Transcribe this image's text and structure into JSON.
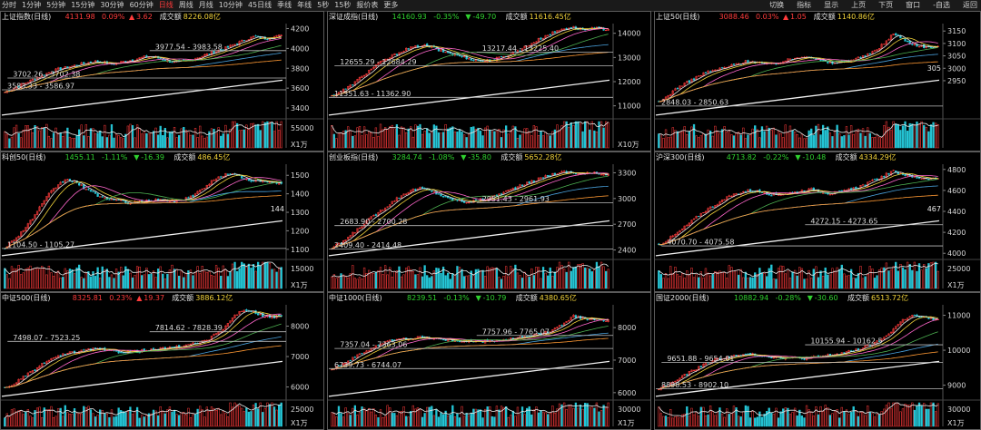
{
  "toolbar": {
    "periods": [
      "分时",
      "1分钟",
      "5分钟",
      "15分钟",
      "30分钟",
      "60分钟",
      "日线",
      "周线",
      "月线",
      "10分钟",
      "45日线",
      "季线",
      "年线",
      "5秒",
      "15秒",
      "报价表",
      "更多"
    ],
    "active_period": "日线",
    "actions": [
      "切换",
      "指标",
      "显示",
      "上页",
      "下页",
      "窗口",
      "-自选",
      "返回"
    ]
  },
  "colors": {
    "up": "#ff3b3b",
    "down": "#2fd22f",
    "white": "#e8e8e8",
    "yellow": "#f2d33a",
    "ma_green": "#4caf50",
    "ma_blue": "#4aa3df",
    "ma_pink": "#ff66cc",
    "ma_orange": "#ff9933",
    "grid": "#3a3a3a",
    "border": "#5a5a5a"
  },
  "panels": [
    {
      "name": "上证指数(日线)",
      "price": "4131.98",
      "pct": "0.09%",
      "chg_sign": "▲",
      "chg": "3.62",
      "vol_label": "成交额",
      "vol": "8226.08亿",
      "dir": "up",
      "y_ticks": [
        "4200",
        "4000",
        "3800",
        "3600",
        "3400"
      ],
      "vol_tick": "55000",
      "vol_unit": "X1万",
      "levels": [
        "3977.54 - 3983.58",
        "3702.26 - 3702.38",
        "3583.33 - 3586.97"
      ],
      "side_label": "",
      "chart_data": {
        "type": "candlestick",
        "ylim": [
          3300,
          4250
        ],
        "close_path": [
          3560,
          3600,
          3640,
          3680,
          3720,
          3760,
          3790,
          3810,
          3830,
          3850,
          3870,
          3860,
          3840,
          3860,
          3880,
          3900,
          3920,
          3910,
          3880,
          3860,
          3870,
          3890,
          3920,
          3950,
          3980,
          4010,
          4050,
          4090,
          4120,
          4100,
          4110,
          4131.98
        ]
      }
    },
    {
      "name": "深证成指(日线)",
      "price": "14160.93",
      "pct": "-0.35%",
      "chg_sign": "▼",
      "chg": "-49.70",
      "vol_label": "成交额",
      "vol": "11616.45亿",
      "dir": "down",
      "y_ticks": [
        "14000",
        "13000",
        "12000",
        "11000"
      ],
      "vol_tick": "",
      "vol_unit": "X10万",
      "levels": [
        "13217.44 - 13225.40",
        "12655.29 - 12684.29",
        "11351.63 - 11362.90"
      ],
      "side_label": "",
      "chart_data": {
        "type": "candlestick",
        "ylim": [
          10500,
          14400
        ],
        "close_path": [
          11400,
          11600,
          11800,
          12100,
          12400,
          12700,
          12900,
          13100,
          13300,
          13400,
          13500,
          13450,
          13300,
          13200,
          13100,
          13000,
          12900,
          12850,
          12900,
          13000,
          13150,
          13300,
          13500,
          13700,
          13900,
          14050,
          14200,
          14250,
          14150,
          14180,
          14200,
          14160.93
        ]
      }
    },
    {
      "name": "上证50(日线)",
      "price": "3088.46",
      "pct": "0.03%",
      "chg_sign": "▲",
      "chg": "1.05",
      "vol_label": "成交额",
      "vol": "1140.86亿",
      "dir": "up",
      "y_ticks": [
        "3150",
        "3100",
        "3050",
        "3000",
        "2950"
      ],
      "vol_tick": "",
      "vol_unit": "",
      "levels": [
        "2848.03 - 2850.63"
      ],
      "side_label": "305",
      "chart_data": {
        "type": "candlestick",
        "ylim": [
          2800,
          3180
        ],
        "close_path": [
          2860,
          2890,
          2920,
          2940,
          2960,
          2980,
          2990,
          3000,
          3010,
          3020,
          3030,
          3025,
          3015,
          3020,
          3030,
          3040,
          3050,
          3045,
          3030,
          3020,
          3025,
          3030,
          3040,
          3050,
          3070,
          3100,
          3140,
          3120,
          3100,
          3090,
          3085,
          3088.46
        ]
      }
    },
    {
      "name": "科创50(日线)",
      "price": "1455.11",
      "pct": "-1.11%",
      "chg_sign": "▼",
      "chg": "-16.39",
      "vol_label": "成交额",
      "vol": "486.45亿",
      "dir": "down",
      "y_ticks": [
        "1500",
        "1400",
        "1300",
        "1200",
        "1100"
      ],
      "vol_tick": "15000",
      "vol_unit": "X1万",
      "levels": [
        "1104.50 - 1105.27"
      ],
      "side_label": "144",
      "chart_data": {
        "type": "candlestick",
        "ylim": [
          1050,
          1560
        ],
        "close_path": [
          1110,
          1150,
          1200,
          1260,
          1330,
          1400,
          1450,
          1480,
          1460,
          1430,
          1400,
          1380,
          1370,
          1360,
          1350,
          1355,
          1360,
          1370,
          1365,
          1360,
          1370,
          1390,
          1420,
          1460,
          1490,
          1510,
          1500,
          1480,
          1470,
          1465,
          1460,
          1455.11
        ]
      }
    },
    {
      "name": "创业板指(日线)",
      "price": "3284.74",
      "pct": "-1.08%",
      "chg_sign": "▼",
      "chg": "-35.80",
      "vol_label": "成交额",
      "vol": "5652.28亿",
      "dir": "down",
      "y_ticks": [
        "3300",
        "3000",
        "2700",
        "2400"
      ],
      "vol_tick": "",
      "vol_unit": "",
      "levels": [
        "2951.43 - 2961.93",
        "2683.90 - 2700.28",
        "2409.40 - 2414.48"
      ],
      "side_label": "",
      "chart_data": {
        "type": "candlestick",
        "ylim": [
          2300,
          3400
        ],
        "close_path": [
          2420,
          2480,
          2560,
          2650,
          2740,
          2820,
          2900,
          2980,
          3050,
          3100,
          3120,
          3090,
          3050,
          3000,
          2980,
          2960,
          2970,
          2990,
          3020,
          3060,
          3100,
          3140,
          3180,
          3220,
          3260,
          3290,
          3310,
          3300,
          3290,
          3295,
          3290,
          3284.74
        ]
      }
    },
    {
      "name": "沪深300(日线)",
      "price": "4713.82",
      "pct": "-0.22%",
      "chg_sign": "▼",
      "chg": "-10.48",
      "vol_label": "成交额",
      "vol": "4334.29亿",
      "dir": "down",
      "y_ticks": [
        "4800",
        "4600",
        "4400",
        "4200",
        "4000"
      ],
      "vol_tick": "25000",
      "vol_unit": "X1万",
      "levels": [
        "4272.15 - 4273.65",
        "4070.70 - 4075.58"
      ],
      "side_label": "467",
      "chart_data": {
        "type": "candlestick",
        "ylim": [
          3950,
          4850
        ],
        "close_path": [
          4080,
          4130,
          4190,
          4260,
          4330,
          4400,
          4450,
          4500,
          4550,
          4580,
          4600,
          4590,
          4570,
          4560,
          4570,
          4580,
          4600,
          4610,
          4590,
          4570,
          4580,
          4600,
          4630,
          4660,
          4700,
          4740,
          4780,
          4760,
          4730,
          4720,
          4715,
          4713.82
        ]
      }
    },
    {
      "name": "中证500(日线)",
      "price": "8325.81",
      "pct": "0.23%",
      "chg_sign": "▲",
      "chg": "19.37",
      "vol_label": "成交额",
      "vol": "3886.12亿",
      "dir": "up",
      "y_ticks": [
        "8000",
        "7000",
        "6000"
      ],
      "vol_tick": "25000",
      "vol_unit": "X1万",
      "levels": [
        "7814.62 - 7828.39",
        "7498.07 - 7523.25"
      ],
      "side_label": "",
      "chart_data": {
        "type": "candlestick",
        "ylim": [
          5600,
          8700
        ],
        "close_path": [
          5950,
          6100,
          6300,
          6500,
          6700,
          6900,
          7000,
          7100,
          7150,
          7200,
          7250,
          7220,
          7180,
          7150,
          7160,
          7180,
          7200,
          7230,
          7260,
          7300,
          7350,
          7400,
          7480,
          7600,
          7800,
          8050,
          8400,
          8550,
          8450,
          8350,
          8300,
          8325.81
        ]
      }
    },
    {
      "name": "中证1000(日线)",
      "price": "8239.51",
      "pct": "-0.13%",
      "chg_sign": "▼",
      "chg": "-10.79",
      "vol_label": "成交额",
      "vol": "4380.65亿",
      "dir": "down",
      "y_ticks": [
        "8000",
        "7000",
        "6000"
      ],
      "vol_tick": "30000",
      "vol_unit": "X1万",
      "levels": [
        "7757.96 - 7765.07",
        "7357.04 - 7363.06",
        "6739.73 - 6744.07"
      ],
      "side_label": "",
      "chart_data": {
        "type": "candlestick",
        "ylim": [
          5800,
          8700
        ],
        "close_path": [
          6750,
          6850,
          7000,
          7150,
          7300,
          7450,
          7550,
          7620,
          7650,
          7680,
          7700,
          7680,
          7650,
          7620,
          7600,
          7580,
          7560,
          7570,
          7590,
          7620,
          7650,
          7680,
          7720,
          7780,
          7850,
          7950,
          8150,
          8350,
          8300,
          8250,
          8240,
          8239.51
        ]
      }
    },
    {
      "name": "国证2000(日线)",
      "price": "10882.94",
      "pct": "-0.28%",
      "chg_sign": "▼",
      "chg": "-30.60",
      "vol_label": "成交额",
      "vol": "6513.72亿",
      "dir": "down",
      "y_ticks": [
        "11000",
        "10000",
        "9000"
      ],
      "vol_tick": "30000",
      "vol_unit": "X1万",
      "levels": [
        "10155.94 - 10162.5",
        "9651.88 - 9654.01",
        "8898.53 - 8902.10"
      ],
      "side_label": "",
      "chart_data": {
        "type": "candlestick",
        "ylim": [
          8600,
          11300
        ],
        "close_path": [
          8900,
          9000,
          9150,
          9300,
          9450,
          9600,
          9700,
          9780,
          9820,
          9850,
          9880,
          9860,
          9830,
          9800,
          9790,
          9780,
          9770,
          9790,
          9820,
          9860,
          9900,
          9950,
          10020,
          10100,
          10200,
          10350,
          10600,
          10850,
          11000,
          10950,
          10900,
          10882.94
        ]
      }
    }
  ]
}
